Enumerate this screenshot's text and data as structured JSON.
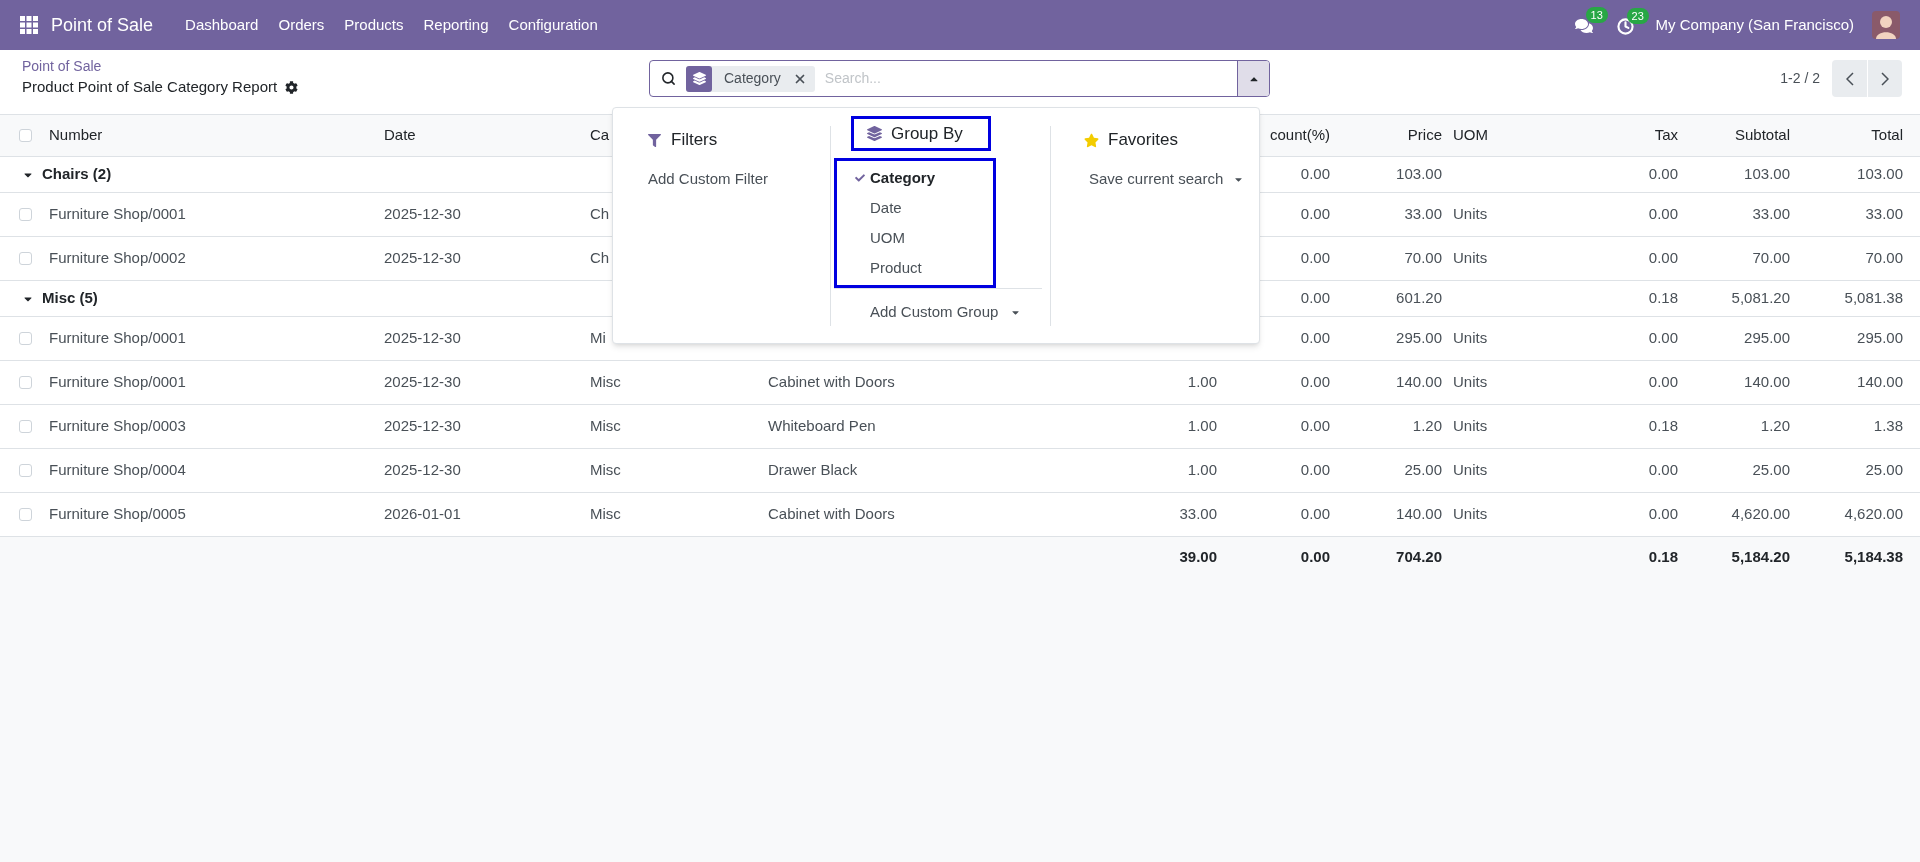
{
  "navbar": {
    "app_name": "Point of Sale",
    "menu": [
      "Dashboard",
      "Orders",
      "Products",
      "Reporting",
      "Configuration"
    ],
    "messages_badge": "13",
    "activities_badge": "23",
    "company": "My Company (San Francisco)"
  },
  "breadcrumb": {
    "parent": "Point of Sale",
    "current": "Product Point of Sale Category Report"
  },
  "search": {
    "facet": "Category",
    "placeholder": "Search..."
  },
  "pager": {
    "range": "1-2 / 2"
  },
  "dropdown": {
    "filters": {
      "title": "Filters",
      "items": [
        "Add Custom Filter"
      ]
    },
    "group_by": {
      "title": "Group By",
      "options": [
        {
          "label": "Category",
          "selected": true
        },
        {
          "label": "Date",
          "selected": false
        },
        {
          "label": "UOM",
          "selected": false
        },
        {
          "label": "Product",
          "selected": false
        }
      ],
      "custom": "Add Custom Group"
    },
    "favorites": {
      "title": "Favorites",
      "items": [
        "Save current search"
      ]
    }
  },
  "table": {
    "all_checked": false,
    "columns": {
      "number": "Number",
      "date": "Date",
      "column_3": "Ca",
      "column_6": "count(%)",
      "price": "Price",
      "uom": "UOM",
      "tax": "Tax",
      "subtotal": "Subtotal",
      "total": "Total"
    },
    "groups": [
      {
        "label": "Chairs (2)",
        "expanded": true,
        "cells": {
          "column_6": "0.00",
          "price": "103.00",
          "tax": "0.00",
          "subtotal": "103.00",
          "total": "103.00"
        },
        "rows": [
          {
            "checked": false,
            "cells": {
              "number": "Furniture Shop/0001",
              "date": "2025-12-30",
              "column_3": "Ch",
              "column_6": "0.00",
              "price": "33.00",
              "uom": "Units",
              "tax": "0.00",
              "subtotal": "33.00",
              "total": "33.00"
            }
          },
          {
            "checked": false,
            "cells": {
              "number": "Furniture Shop/0002",
              "date": "2025-12-30",
              "column_3": "Ch",
              "column_6": "0.00",
              "price": "70.00",
              "uom": "Units",
              "tax": "0.00",
              "subtotal": "70.00",
              "total": "70.00"
            }
          }
        ]
      },
      {
        "label": "Misc (5)",
        "expanded": true,
        "cells": {
          "column_6": "0.00",
          "price": "601.20",
          "tax": "0.18",
          "subtotal": "5,081.20",
          "total": "5,081.38"
        },
        "rows": [
          {
            "checked": false,
            "cells": {
              "number": "Furniture Shop/0001",
              "date": "2025-12-30",
              "column_3": "Mi",
              "column_6": "0.00",
              "price": "295.00",
              "uom": "Units",
              "tax": "0.00",
              "subtotal": "295.00",
              "total": "295.00"
            }
          },
          {
            "checked": false,
            "cells": {
              "number": "Furniture Shop/0001",
              "date": "2025-12-30",
              "column_3": "Misc",
              "column_4": "Cabinet with Doors",
              "column_5": "1.00",
              "column_6": "0.00",
              "price": "140.00",
              "uom": "Units",
              "tax": "0.00",
              "subtotal": "140.00",
              "total": "140.00"
            }
          },
          {
            "checked": false,
            "cells": {
              "number": "Furniture Shop/0003",
              "date": "2025-12-30",
              "column_3": "Misc",
              "column_4": "Whiteboard Pen",
              "column_5": "1.00",
              "column_6": "0.00",
              "price": "1.20",
              "uom": "Units",
              "tax": "0.18",
              "subtotal": "1.20",
              "total": "1.38"
            }
          },
          {
            "checked": false,
            "cells": {
              "number": "Furniture Shop/0004",
              "date": "2025-12-30",
              "column_3": "Misc",
              "column_4": "Drawer Black",
              "column_5": "1.00",
              "column_6": "0.00",
              "price": "25.00",
              "uom": "Units",
              "tax": "0.00",
              "subtotal": "25.00",
              "total": "25.00"
            }
          },
          {
            "checked": false,
            "cells": {
              "number": "Furniture Shop/0005",
              "date": "2026-01-01",
              "column_3": "Misc",
              "column_4": "Cabinet with Doors",
              "column_5": "33.00",
              "column_6": "0.00",
              "price": "140.00",
              "uom": "Units",
              "tax": "0.00",
              "subtotal": "4,620.00",
              "total": "4,620.00"
            }
          }
        ]
      }
    ],
    "totals": {
      "column_5": "39.00",
      "column_6": "0.00",
      "price": "704.20",
      "tax": "0.18",
      "subtotal": "5,184.20",
      "total": "5,184.38"
    }
  }
}
